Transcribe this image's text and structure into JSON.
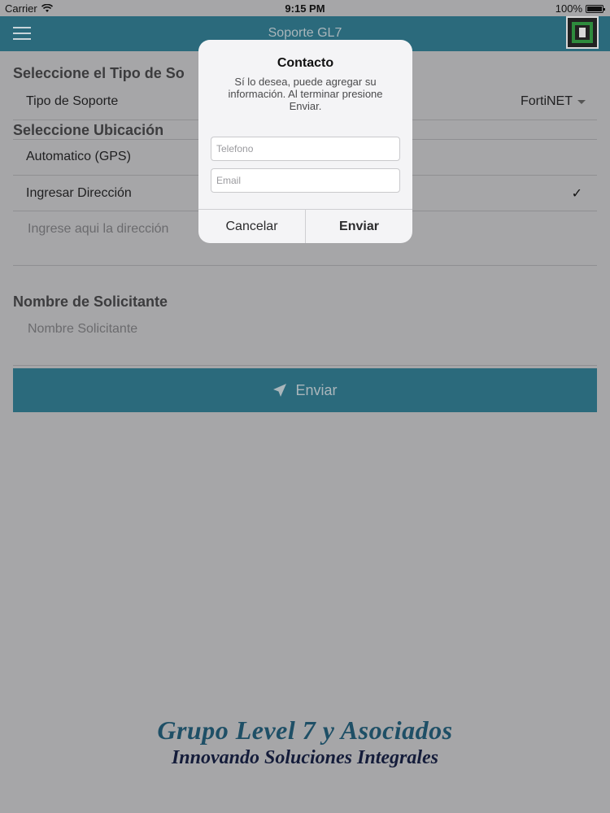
{
  "status_bar": {
    "carrier": "Carrier",
    "time": "9:15 PM",
    "battery": "100%"
  },
  "nav": {
    "title": "Soporte GL7",
    "menu_icon": "hamburger-icon",
    "logo_icon": "gl7-logo"
  },
  "form": {
    "section_type": "Seleccione el Tipo de So",
    "support_type_label": "Tipo de Soporte",
    "support_type_value": "FortiNET",
    "section_location": "Seleccione Ubicación",
    "location_gps": "Automatico (GPS)",
    "location_manual": "Ingresar Dirección",
    "check_mark": "✓",
    "address_placeholder": "Ingrese aqui la dirección",
    "section_name": "Nombre de Solicitante",
    "name_placeholder": "Nombre Solicitante",
    "submit_label": "Enviar",
    "submit_icon": "paper-plane-icon"
  },
  "footer": {
    "line1": "Grupo Level 7 y Asociados",
    "line2": "Innovando Soluciones Integrales"
  },
  "dialog": {
    "title": "Contacto",
    "message": "Sí lo desea, puede agregar su información. Al terminar presione Enviar.",
    "phone_placeholder": "Telefono",
    "email_placeholder": "Email",
    "cancel_label": "Cancelar",
    "send_label": "Enviar"
  },
  "colors": {
    "accent": "#2b6a7c",
    "overlay_bg": "#a6a6a8",
    "dialog_bg": "#f4f4f6"
  }
}
